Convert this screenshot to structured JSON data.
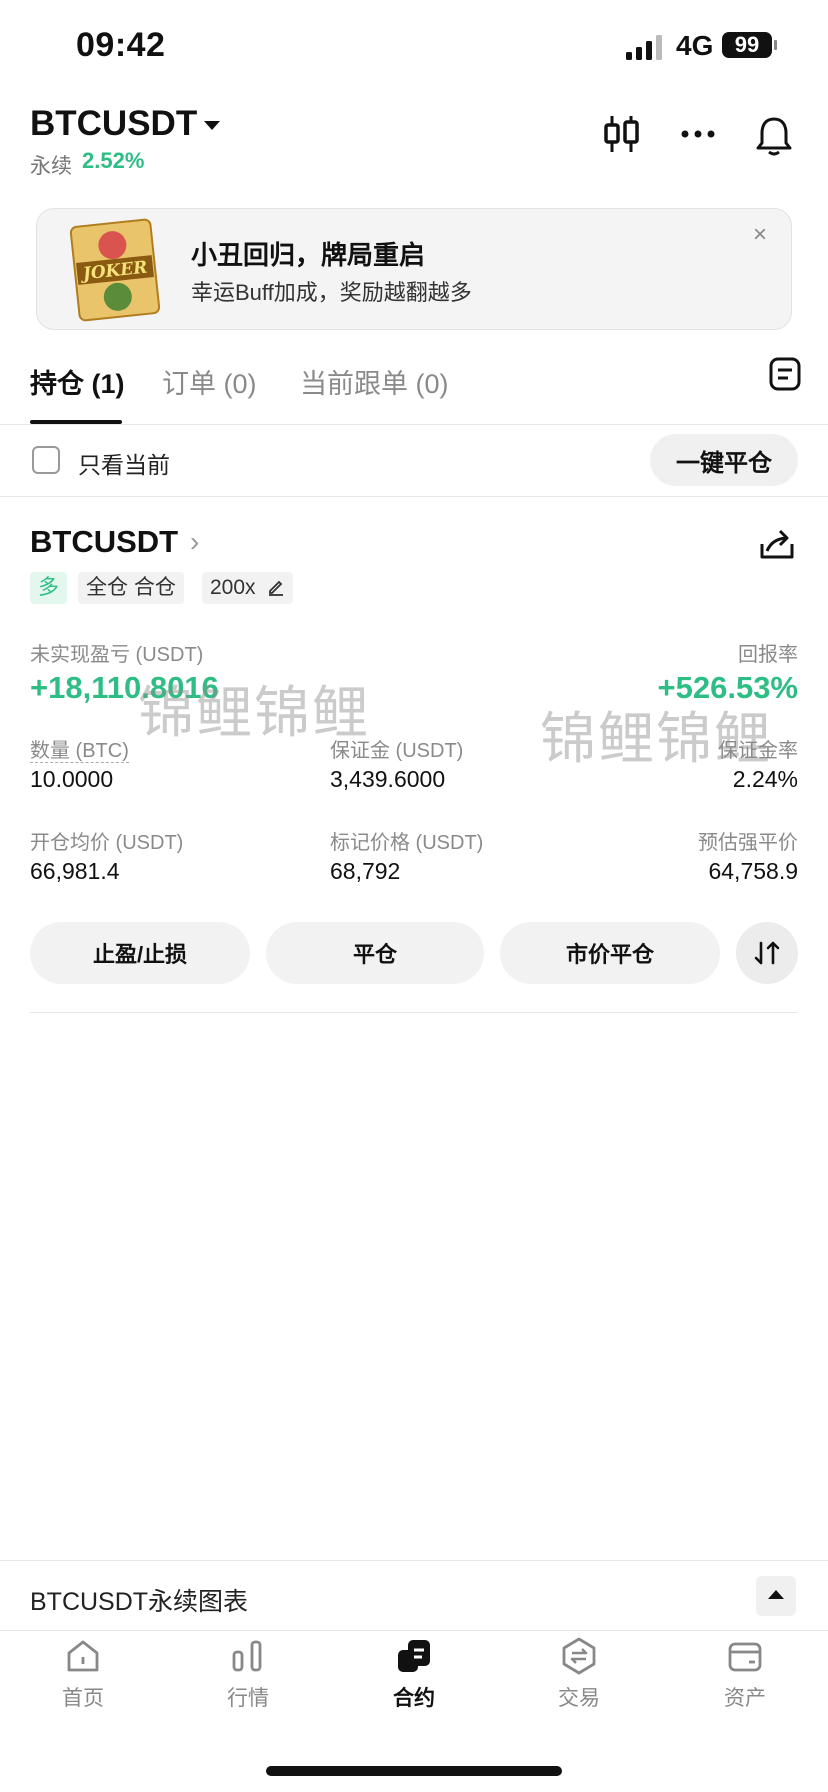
{
  "status_bar": {
    "time": "09:42",
    "network": "4G",
    "battery": "99"
  },
  "header": {
    "symbol": "BTCUSDT",
    "type_label": "永续",
    "change": "2.52%"
  },
  "banner": {
    "title": "小丑回归，牌局重启",
    "subtitle": "幸运Buff加成，奖励越翻越多",
    "badge_text": "JOKER",
    "close": "×"
  },
  "tabs": [
    {
      "label": "持仓 (1)"
    },
    {
      "label": "订单 (0)"
    },
    {
      "label": "当前跟单 (0)"
    }
  ],
  "filter": {
    "only_current": "只看当前",
    "close_all": "一键平仓"
  },
  "position": {
    "symbol": "BTCUSDT",
    "chevron": "›",
    "side": "多",
    "margin_mode": "全仓 合仓",
    "leverage": "200x",
    "unrealized_pnl_label": "未实现盈亏 (USDT)",
    "unrealized_pnl": "+18,110.8016",
    "roe_label": "回报率",
    "roe": "+526.53%",
    "qty_label": "数量 (BTC)",
    "qty": "10.0000",
    "margin_label": "保证金 (USDT)",
    "margin": "3,439.6000",
    "margin_ratio_label": "保证金率",
    "margin_ratio": "2.24%",
    "entry_label": "开仓均价 (USDT)",
    "entry": "66,981.4",
    "mark_label": "标记价格 (USDT)",
    "mark": "68,792",
    "liq_label": "预估强平价",
    "liq": "64,758.9"
  },
  "watermarks": [
    "锦鲤锦鲤",
    "锦鲤锦鲤"
  ],
  "actions": {
    "tpsl": "止盈/止损",
    "close": "平仓",
    "market_close": "市价平仓"
  },
  "chart_bar": {
    "label": "BTCUSDT永续图表"
  },
  "nav": [
    {
      "label": "首页",
      "icon": "home-icon"
    },
    {
      "label": "行情",
      "icon": "market-icon"
    },
    {
      "label": "合约",
      "icon": "futures-icon"
    },
    {
      "label": "交易",
      "icon": "trade-icon"
    },
    {
      "label": "资产",
      "icon": "wallet-icon"
    }
  ],
  "colors": {
    "green": "#2ebd85",
    "text": "#111111",
    "muted": "#8a8a8a"
  }
}
